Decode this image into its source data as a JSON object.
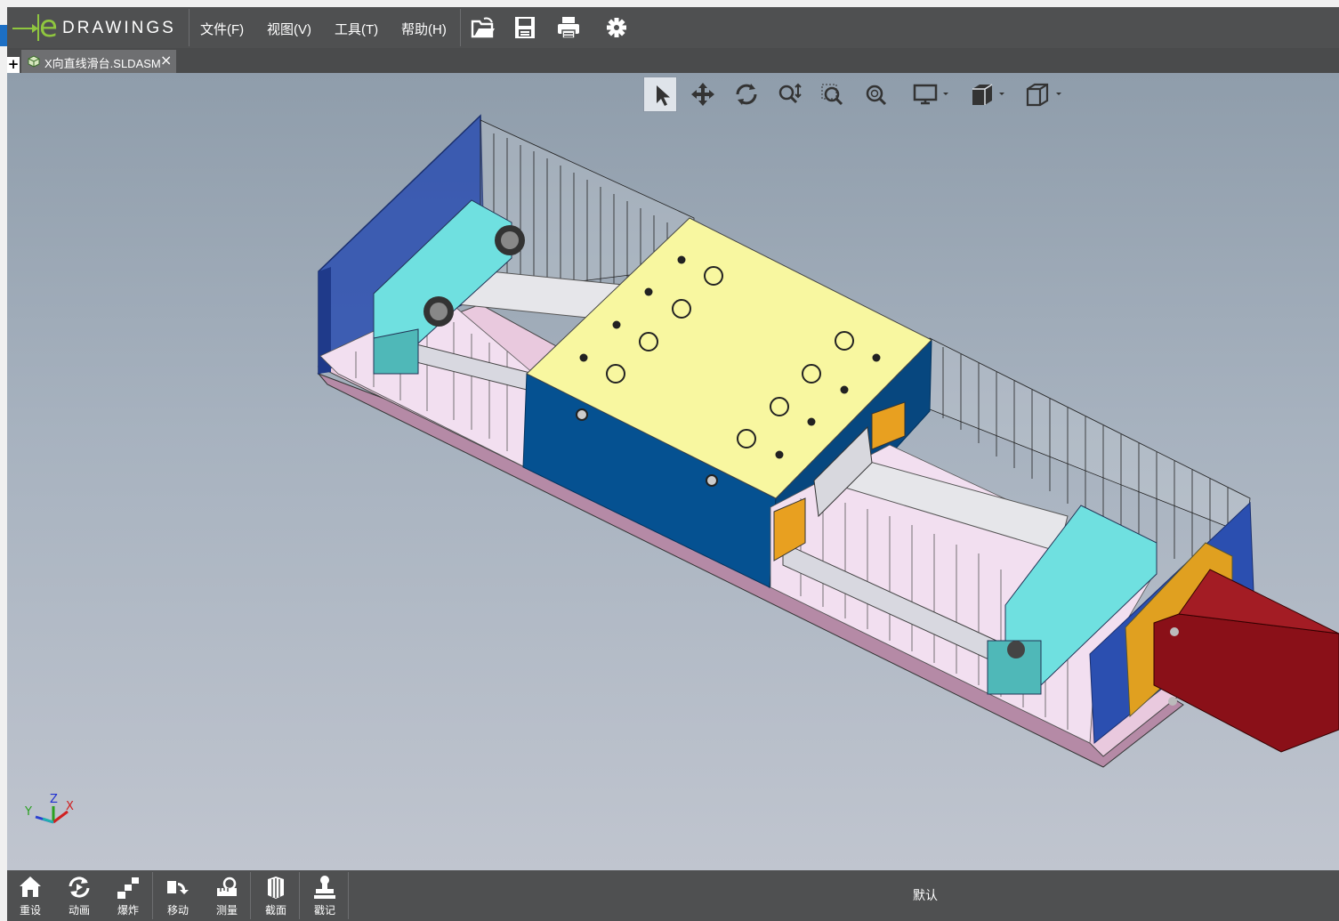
{
  "app": {
    "logo_text": "DRAWINGS",
    "logo_letter": "e"
  },
  "menu": [
    {
      "label": "文件(F)"
    },
    {
      "label": "视图(V)"
    },
    {
      "label": "工具(T)"
    },
    {
      "label": "帮助(H)"
    }
  ],
  "toolbar": [
    "open-icon",
    "save-icon",
    "print-icon",
    "settings-icon"
  ],
  "tabs": {
    "plus": "+",
    "document": "X向直线滑台.SLDASM",
    "close": "×"
  },
  "view_toolbar": [
    "select-icon",
    "pan-icon",
    "rotate-icon",
    "zoom-icon",
    "zoom-to-area-icon",
    "zoom-to-fit-icon",
    "display-icon",
    "shading-icon",
    "view-orientation-icon"
  ],
  "triad": {
    "x": "X",
    "y": "Y",
    "z": "Z"
  },
  "bottom_bar": {
    "buttons": [
      {
        "label": "重设"
      },
      {
        "label": "动画"
      },
      {
        "label": "爆炸"
      },
      {
        "label": "移动"
      },
      {
        "label": "测量"
      },
      {
        "label": "截面"
      },
      {
        "label": "戳记"
      }
    ],
    "configuration": "默认"
  },
  "colors": {
    "menubar": "#4f5051",
    "accent_green": "#8fc63f",
    "carriage_top": "#f8f7a0",
    "carriage_side": "#055191",
    "end_plate": "#2b4fb0",
    "support_block": "#6fe0e0",
    "motor": "#8a1018",
    "motor_flange": "#e0a020",
    "base": "#e9c9de"
  }
}
